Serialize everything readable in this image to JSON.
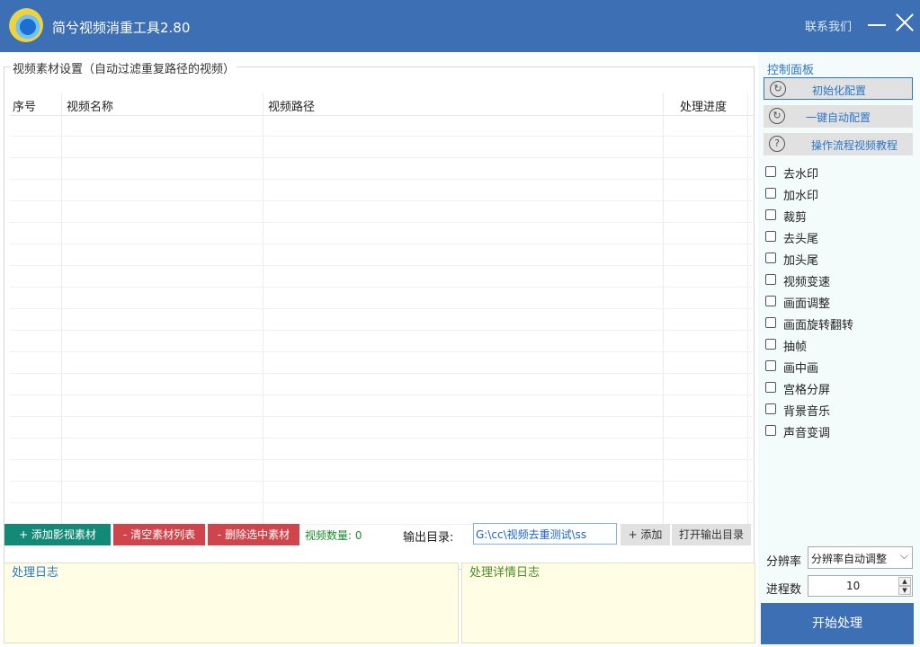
{
  "app": {
    "title": "简兮视频消重工具2.80",
    "contact": "联系我们",
    "logo_icon": "app-logo"
  },
  "materials": {
    "group_title": "视频素材设置（自动过滤重复路径的视频）",
    "columns": [
      "序号",
      "视频名称",
      "视频路径",
      "处理进度"
    ],
    "rows": []
  },
  "toolbar": {
    "add_video": "+ 添加影视素材",
    "clear_list": "- 清空素材列表",
    "delete_selected": "- 删除选中素材",
    "video_count": "视频数量: 0",
    "output_label": "输出目录:",
    "output_value": "G:\\cc\\视频去重测试\\ss",
    "add": "+ 添加",
    "open_output": "打开输出目录"
  },
  "logs": {
    "process_log": "处理日志",
    "detail_log": "处理详情日志"
  },
  "control_panel": {
    "title": "控制面板",
    "buttons": [
      {
        "label": "初始化配置",
        "icon": "refresh-icon"
      },
      {
        "label": "一键自动配置",
        "icon": "auto-config-icon"
      },
      {
        "label": "操作流程视频教程",
        "icon": "help-icon"
      }
    ],
    "options": [
      {
        "label": "去水印",
        "checked": false
      },
      {
        "label": "加水印",
        "checked": false
      },
      {
        "label": "裁剪",
        "checked": false
      },
      {
        "label": "去头尾",
        "checked": false
      },
      {
        "label": "加头尾",
        "checked": false
      },
      {
        "label": "视频变速",
        "checked": false
      },
      {
        "label": "画面调整",
        "checked": false
      },
      {
        "label": "画面旋转翻转",
        "checked": false
      },
      {
        "label": "抽帧",
        "checked": false
      },
      {
        "label": "画中画",
        "checked": false
      },
      {
        "label": "宫格分屏",
        "checked": false
      },
      {
        "label": "背景音乐",
        "checked": false
      },
      {
        "label": "声音变调",
        "checked": false
      }
    ],
    "resolution_label": "分辨率",
    "resolution_value": "分辨率自动调整",
    "process_count_label": "进程数",
    "process_count_value": "10",
    "start_button": "开始处理"
  },
  "colors": {
    "titlebar": "#3c6fb4",
    "add_button": "#138a78",
    "danger_button": "#d0454b",
    "accent_text": "#2a76c9",
    "log_background": "#fffee5"
  }
}
